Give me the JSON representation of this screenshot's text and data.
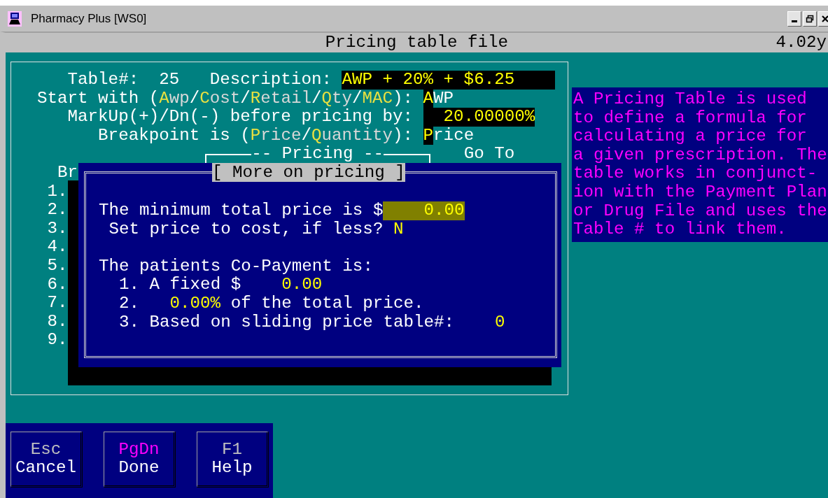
{
  "window": {
    "title": "Pharmacy Plus [WS0]"
  },
  "header": {
    "title": "Pricing table file",
    "version": "4.02y"
  },
  "form": {
    "table_label": "Table#:",
    "table_number": "25",
    "description_label": "Description:",
    "description": "AWP + 20% + $6.25",
    "start_with": [
      {
        "text": "Start with (",
        "kind": "label"
      },
      {
        "text": "A",
        "kind": "hotkey"
      },
      {
        "text": "wp",
        "kind": "option"
      },
      {
        "text": "/",
        "kind": "label"
      },
      {
        "text": "C",
        "kind": "hotkey"
      },
      {
        "text": "ost",
        "kind": "option"
      },
      {
        "text": "/",
        "kind": "label"
      },
      {
        "text": "R",
        "kind": "hotkey"
      },
      {
        "text": "etail",
        "kind": "option"
      },
      {
        "text": "/",
        "kind": "label"
      },
      {
        "text": "Q",
        "kind": "hotkey"
      },
      {
        "text": "ty",
        "kind": "option"
      },
      {
        "text": "/",
        "kind": "label"
      },
      {
        "text": "MAC",
        "kind": "hotkey"
      },
      {
        "text": "):",
        "kind": "label"
      }
    ],
    "start_with_value": "AWP",
    "markup_label": "MarkUp(+)/Dn(-) before pricing by:",
    "markup": "20.00000%",
    "breakpoint": [
      {
        "text": "Breakpoint is (",
        "kind": "label"
      },
      {
        "text": "P",
        "kind": "hotkey"
      },
      {
        "text": "rice",
        "kind": "option"
      },
      {
        "text": "/",
        "kind": "label"
      },
      {
        "text": "Q",
        "kind": "hotkey"
      },
      {
        "text": "uantity",
        "kind": "option"
      },
      {
        "text": "):",
        "kind": "label"
      }
    ],
    "breakpoint_value": "Price",
    "pricing_heading": "-- Pricing --",
    "goto_label": "Go To",
    "column_1": "Br",
    "row_numbers": [
      "1.",
      "2.",
      "3.",
      "4.",
      "5.",
      "6.",
      "7.",
      "8.",
      "9."
    ]
  },
  "dialog": {
    "title": "[ More on pricing ]",
    "min_price_label": "The minimum total price is $",
    "min_price": "0.00",
    "cost_label": "Set price to cost, if less?",
    "cost_value": "N",
    "copay_label": "The patients Co-Payment is:",
    "copay_options": [
      {
        "number": "1.",
        "parts": [
          {
            "text": "A fixed $",
            "kind": "label"
          },
          {
            "text": "0.00",
            "kind": "value"
          }
        ]
      },
      {
        "number": "2.",
        "parts": [
          {
            "text": "0.00%",
            "kind": "value"
          },
          {
            "text": "of the total price.",
            "kind": "label"
          }
        ]
      },
      {
        "number": "3.",
        "parts": [
          {
            "text": "Based on sliding price table#:",
            "kind": "label"
          },
          {
            "text": "0",
            "kind": "value"
          }
        ]
      }
    ]
  },
  "help": {
    "lines": [
      "A Pricing Table is used",
      "to define a formula for",
      "calculating a price for",
      "a given prescription. The",
      "table works in conjunct-",
      "ion with the Payment Plan",
      "or Drug File and uses the",
      "Table # to link them."
    ]
  },
  "buttons": [
    {
      "key": "Esc",
      "label": "Cancel",
      "color": "#c0c0c0"
    },
    {
      "key": "PgDn",
      "label": "Done",
      "color": "#ff00ff"
    },
    {
      "key": "F1",
      "label": "Help",
      "color": "#c0c0c0"
    }
  ]
}
